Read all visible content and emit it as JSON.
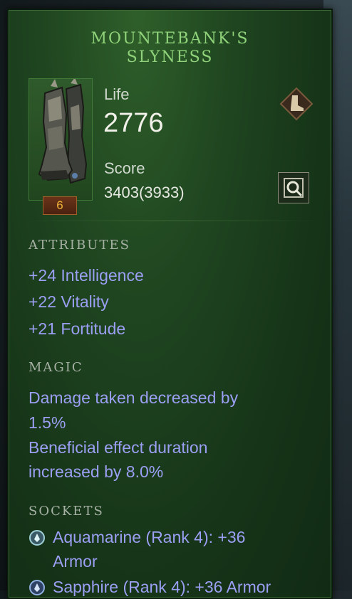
{
  "item": {
    "name_line1": "MOUNTEBANK'S",
    "name_line2": "SLYNESS",
    "rank": "6",
    "slot_icon": "boots-icon"
  },
  "stats": {
    "life_label": "Life",
    "life_value": "2776",
    "score_label": "Score",
    "score_value": "3403(3933)"
  },
  "attributes": {
    "heading": "ATTRIBUTES",
    "lines": [
      "+24 Intelligence",
      "+22 Vitality",
      "+21 Fortitude"
    ]
  },
  "magic": {
    "heading": "MAGIC",
    "lines": [
      "Damage taken decreased by",
      "1.5%",
      "Beneficial effect duration",
      "increased by 8.0%"
    ]
  },
  "sockets": {
    "heading": "SOCKETS",
    "items": [
      {
        "line1": "Aquamarine (Rank 4): +36",
        "line2": "Armor",
        "icon": "aquamarine-gem-icon"
      },
      {
        "line1": "Sapphire (Rank 4): +36 Armor",
        "icon": "sapphire-gem-icon"
      }
    ]
  },
  "colors": {
    "title": "#8fd27a",
    "magic_text": "#9b9ff3",
    "rank_text": "#f0b33a"
  }
}
